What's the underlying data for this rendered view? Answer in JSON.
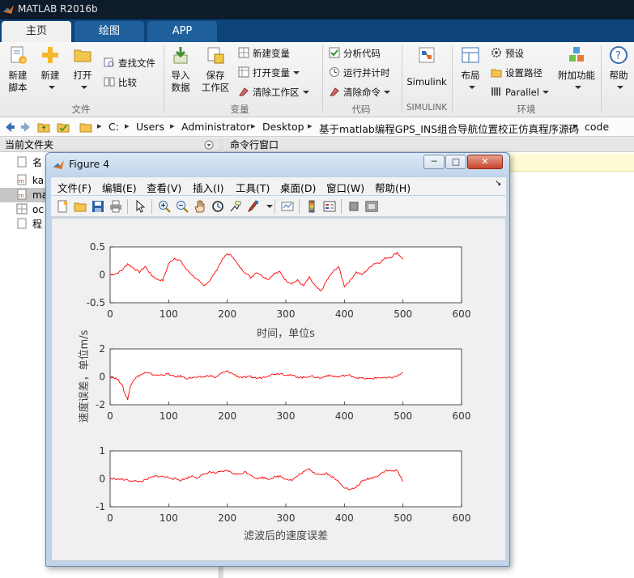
{
  "app": {
    "title": "MATLAB R2016b"
  },
  "tabs": [
    {
      "label": "主页"
    },
    {
      "label": "绘图"
    },
    {
      "label": "APP"
    }
  ],
  "ribbon": {
    "file": {
      "new_script": [
        "新建",
        "脚本"
      ],
      "new": "新建",
      "open": "打开",
      "find_files": "查找文件",
      "compare": "比较",
      "group_label": "文件"
    },
    "variable": {
      "import": [
        "导入",
        "数据"
      ],
      "save": [
        "保存",
        "工作区"
      ],
      "new_variable": "新建变量",
      "open_variable": "打开变量",
      "clear_workspace": "清除工作区",
      "group_label": "变量"
    },
    "code": {
      "analyze": "分析代码",
      "run_time": "运行并计时",
      "clear_commands": "清除命令",
      "group_label": "代码"
    },
    "simulink": {
      "label": "Simulink",
      "group_label": "SIMULINK"
    },
    "environment": {
      "layout": "布局",
      "preferences": "预设",
      "set_path": "设置路径",
      "parallel": "Parallel",
      "addons": "附加功能",
      "group_label": "环境"
    },
    "resources": {
      "help": "帮助"
    }
  },
  "address": {
    "crumbs": [
      "C:",
      "Users",
      "Administrator",
      "Desktop",
      "基于matlab编程GPS_INS组合导航位置校正仿真程序源码",
      "code"
    ]
  },
  "panels": {
    "current_folder": "当前文件夹",
    "command_window": "命令行窗口",
    "files": [
      {
        "name": "名",
        "icon": "doc-icon"
      },
      {
        "name": "ka",
        "icon": "mfile-icon"
      },
      {
        "name": "ma",
        "icon": "mfile-icon"
      },
      {
        "name": "oc",
        "icon": "grid-icon"
      },
      {
        "name": "程",
        "icon": "doc-icon"
      }
    ]
  },
  "figure": {
    "title": "Figure 4",
    "menu": [
      "文件(F)",
      "编辑(E)",
      "查看(V)",
      "插入(I)",
      "工具(T)",
      "桌面(D)",
      "窗口(W)",
      "帮助(H)"
    ]
  },
  "chart_data": [
    {
      "type": "line",
      "x": [
        0,
        10,
        20,
        30,
        40,
        50,
        60,
        70,
        80,
        90,
        100,
        110,
        120,
        130,
        140,
        150,
        160,
        170,
        180,
        190,
        200,
        210,
        220,
        230,
        240,
        250,
        260,
        270,
        280,
        290,
        300,
        310,
        320,
        330,
        340,
        350,
        360,
        370,
        380,
        390,
        400,
        410,
        420,
        430,
        440,
        450,
        460,
        470,
        480,
        490,
        500
      ],
      "series": [
        {
          "values": [
            0.0,
            0.02,
            0.08,
            0.2,
            0.12,
            0.05,
            0.15,
            0.0,
            -0.08,
            -0.1,
            0.2,
            0.3,
            0.25,
            0.1,
            0.0,
            -0.1,
            -0.2,
            -0.1,
            0.05,
            0.25,
            0.38,
            0.32,
            0.15,
            0.05,
            -0.05,
            0.05,
            -0.02,
            -0.08,
            0.02,
            0.05,
            -0.1,
            -0.15,
            -0.1,
            -0.2,
            -0.05,
            -0.2,
            -0.3,
            -0.1,
            0.05,
            0.15,
            -0.2,
            -0.1,
            0.05,
            0.0,
            0.1,
            0.2,
            0.22,
            0.3,
            0.32,
            0.4,
            0.28
          ]
        }
      ],
      "xlabel": "时间，单位s",
      "xlim": [
        0,
        600
      ],
      "ylim": [
        -0.5,
        0.5
      ],
      "yticks": [
        "0.5",
        "0",
        "-0.5"
      ],
      "xticks": [
        "0",
        "100",
        "200",
        "300",
        "400",
        "500",
        "600"
      ],
      "color": "#ff0000"
    },
    {
      "type": "line",
      "x": [
        0,
        10,
        20,
        25,
        30,
        35,
        40,
        50,
        60,
        70,
        80,
        90,
        100,
        110,
        120,
        130,
        140,
        150,
        160,
        170,
        180,
        190,
        200,
        210,
        220,
        230,
        240,
        250,
        260,
        270,
        280,
        290,
        300,
        310,
        320,
        330,
        340,
        350,
        360,
        370,
        380,
        390,
        400,
        410,
        420,
        430,
        440,
        450,
        460,
        470,
        480,
        490,
        500
      ],
      "series": [
        {
          "values": [
            0.0,
            -0.1,
            -0.5,
            -1.2,
            -1.6,
            -0.6,
            -0.2,
            0.1,
            0.3,
            0.2,
            0.1,
            0.15,
            0.2,
            0.0,
            0.05,
            -0.1,
            -0.05,
            -0.05,
            0.0,
            0.1,
            -0.05,
            0.25,
            0.4,
            0.2,
            0.0,
            -0.05,
            0.0,
            -0.1,
            -0.05,
            0.1,
            0.2,
            0.25,
            0.15,
            0.1,
            0.0,
            -0.05,
            0.05,
            0.0,
            -0.1,
            0.1,
            0.05,
            0.0,
            0.1,
            0.1,
            -0.05,
            -0.1,
            -0.15,
            -0.1,
            -0.05,
            -0.1,
            -0.05,
            0.05,
            0.3
          ]
        }
      ],
      "ylabel": "速度误差，单位m/s",
      "xlim": [
        0,
        600
      ],
      "ylim": [
        -2,
        2
      ],
      "yticks": [
        "2",
        "0",
        "-2"
      ],
      "xticks": [
        "0",
        "100",
        "200",
        "300",
        "400",
        "500",
        "600"
      ],
      "color": "#ff0000"
    },
    {
      "type": "line",
      "x": [
        0,
        10,
        20,
        30,
        40,
        50,
        60,
        70,
        80,
        90,
        100,
        110,
        120,
        130,
        140,
        150,
        160,
        170,
        180,
        190,
        200,
        210,
        220,
        230,
        240,
        250,
        260,
        270,
        280,
        290,
        300,
        310,
        320,
        330,
        340,
        350,
        360,
        370,
        380,
        390,
        400,
        410,
        420,
        430,
        440,
        450,
        460,
        470,
        480,
        490,
        500
      ],
      "series": [
        {
          "values": [
            0.0,
            0.0,
            -0.02,
            -0.05,
            -0.08,
            -0.1,
            -0.05,
            0.05,
            0.1,
            0.08,
            0.05,
            0.0,
            -0.05,
            0.02,
            0.1,
            0.05,
            0.15,
            0.25,
            0.2,
            0.25,
            0.3,
            0.2,
            0.15,
            0.25,
            0.15,
            0.0,
            0.05,
            0.0,
            0.05,
            0.1,
            0.0,
            -0.05,
            0.1,
            0.25,
            0.35,
            0.2,
            0.15,
            0.2,
            0.05,
            -0.1,
            -0.3,
            -0.4,
            -0.3,
            -0.1,
            0.0,
            0.05,
            0.15,
            0.3,
            0.28,
            0.3,
            -0.1
          ]
        }
      ],
      "xlabel": "滤波后的速度误差",
      "xlim": [
        0,
        600
      ],
      "ylim": [
        -1,
        1
      ],
      "yticks": [
        "1",
        "0",
        "-1"
      ],
      "xticks": [
        "0",
        "100",
        "200",
        "300",
        "400",
        "500",
        "600"
      ],
      "color": "#ff0000"
    }
  ]
}
